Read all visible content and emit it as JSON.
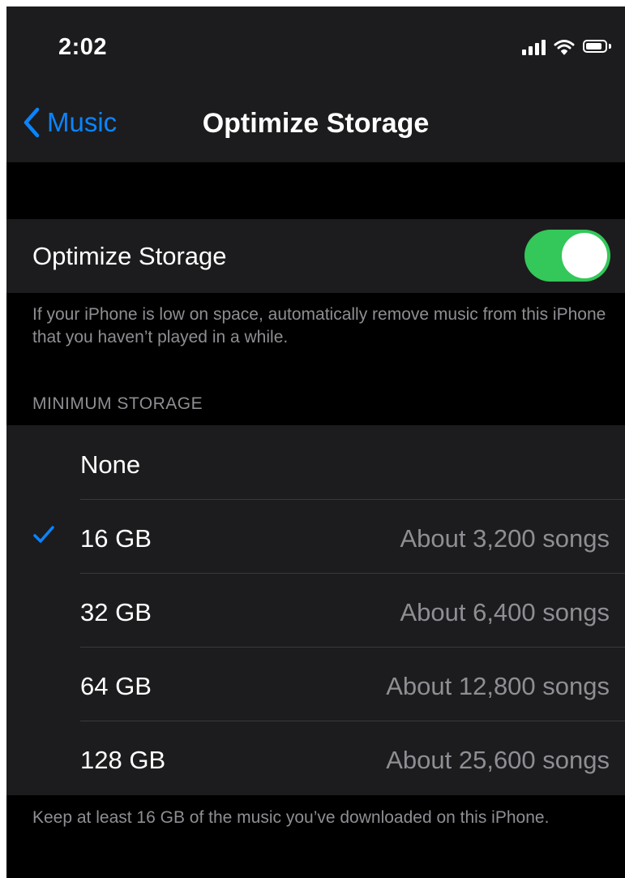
{
  "status_bar": {
    "time": "2:02"
  },
  "nav": {
    "back_label": "Music",
    "title": "Optimize Storage"
  },
  "toggle": {
    "label": "Optimize Storage",
    "on": true
  },
  "toggle_footer": "If your iPhone is low on space, automatically remove music from this iPhone that you haven’t played in a while.",
  "section_header": "MINIMUM STORAGE",
  "options": [
    {
      "label": "None",
      "detail": "",
      "selected": false
    },
    {
      "label": "16 GB",
      "detail": "About 3,200 songs",
      "selected": true
    },
    {
      "label": "32 GB",
      "detail": "About 6,400 songs",
      "selected": false
    },
    {
      "label": "64 GB",
      "detail": "About 12,800 songs",
      "selected": false
    },
    {
      "label": "128 GB",
      "detail": "About 25,600 songs",
      "selected": false
    }
  ],
  "list_footer": "Keep at least 16 GB of the music you’ve downloaded on this iPhone.",
  "colors": {
    "accent": "#0a84ff",
    "switch_on": "#34c759",
    "background": "#000000",
    "cell": "#1c1c1e",
    "secondary_text": "#8e8e93"
  }
}
